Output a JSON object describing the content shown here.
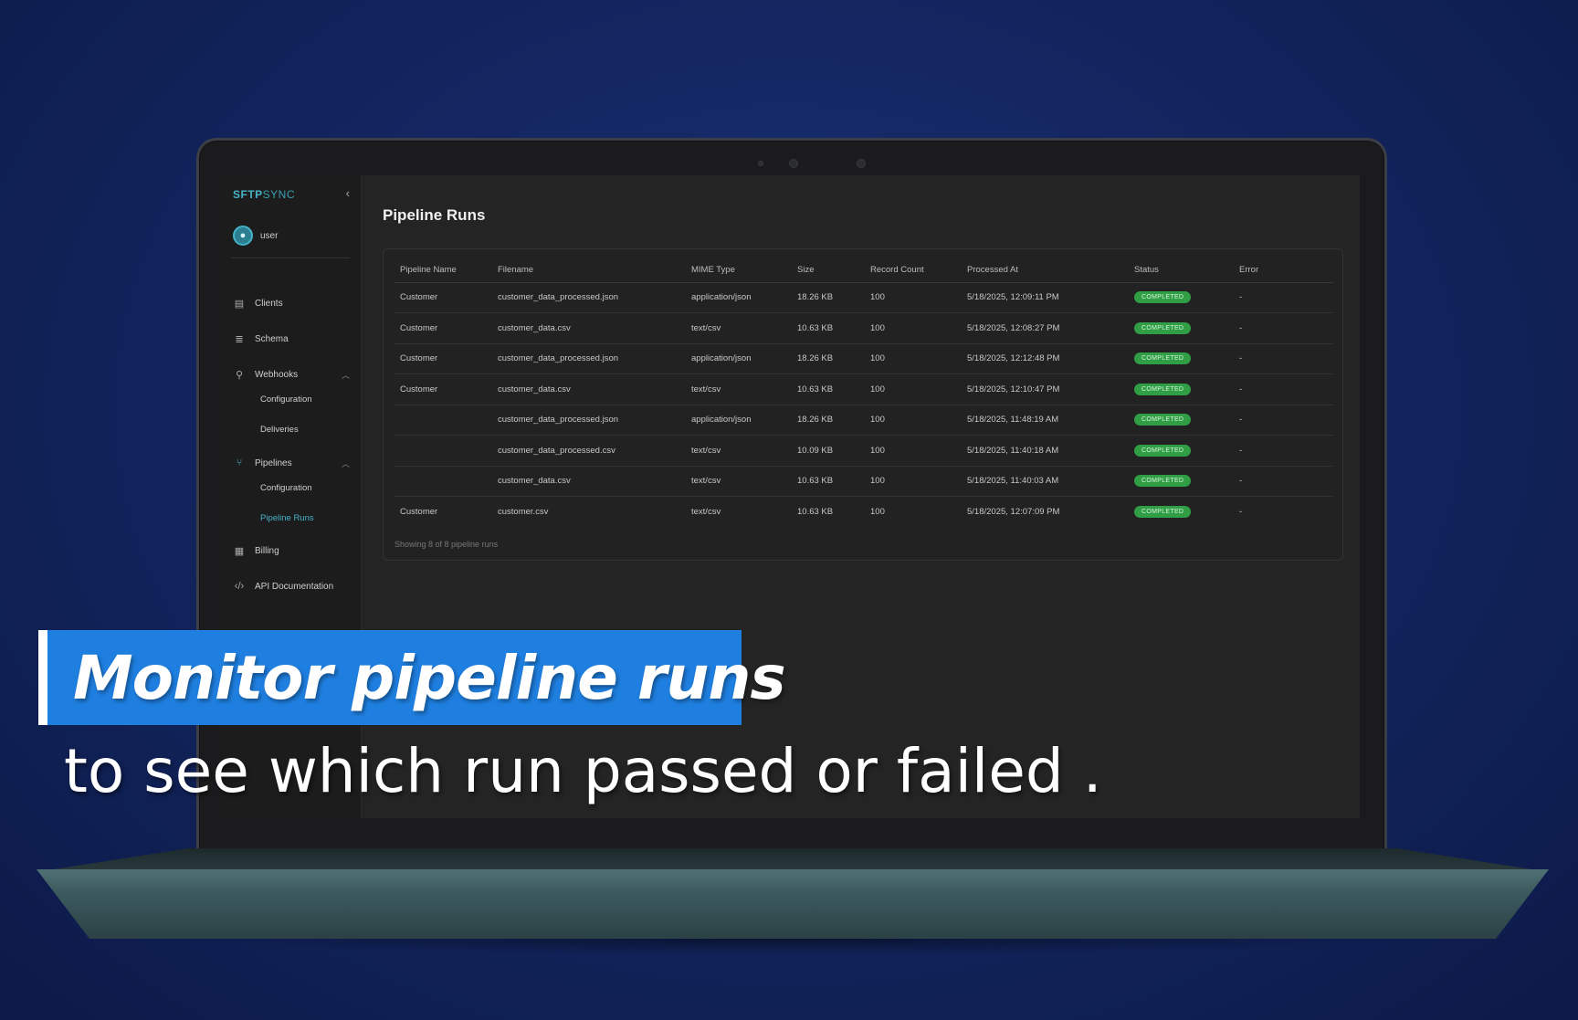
{
  "app": {
    "brand_bold": "SFTP",
    "brand_light": "SYNC",
    "user": "user"
  },
  "sidebar": {
    "items": [
      {
        "label": "Clients",
        "icon": "server-icon"
      },
      {
        "label": "Schema",
        "icon": "database-icon"
      },
      {
        "label": "Webhooks",
        "icon": "webhook-icon"
      },
      {
        "label": "Configuration"
      },
      {
        "label": "Deliveries"
      },
      {
        "label": "Pipelines",
        "icon": "git-branch-icon"
      },
      {
        "label": "Configuration"
      },
      {
        "label": "Pipeline Runs"
      },
      {
        "label": "Billing",
        "icon": "receipt-icon"
      },
      {
        "label": "API Documentation",
        "icon": "code-icon"
      }
    ]
  },
  "main": {
    "title": "Pipeline Runs",
    "columns": [
      "Pipeline Name",
      "Filename",
      "MIME Type",
      "Size",
      "Record Count",
      "Processed At",
      "Status",
      "Error"
    ],
    "rows": [
      {
        "pipeline": "Customer",
        "filename": "customer_data_processed.json",
        "mime": "application/json",
        "size": "18.26 KB",
        "records": "100",
        "processed": "5/18/2025, 12:09:11 PM",
        "status": "COMPLETED",
        "error": "-"
      },
      {
        "pipeline": "Customer",
        "filename": "customer_data.csv",
        "mime": "text/csv",
        "size": "10.63 KB",
        "records": "100",
        "processed": "5/18/2025, 12:08:27 PM",
        "status": "COMPLETED",
        "error": "-"
      },
      {
        "pipeline": "Customer",
        "filename": "customer_data_processed.json",
        "mime": "application/json",
        "size": "18.26 KB",
        "records": "100",
        "processed": "5/18/2025, 12:12:48 PM",
        "status": "COMPLETED",
        "error": "-"
      },
      {
        "pipeline": "Customer",
        "filename": "customer_data.csv",
        "mime": "text/csv",
        "size": "10.63 KB",
        "records": "100",
        "processed": "5/18/2025, 12:10:47 PM",
        "status": "COMPLETED",
        "error": "-"
      },
      {
        "pipeline": "",
        "filename": "customer_data_processed.json",
        "mime": "application/json",
        "size": "18.26 KB",
        "records": "100",
        "processed": "5/18/2025, 11:48:19 AM",
        "status": "COMPLETED",
        "error": "-"
      },
      {
        "pipeline": "",
        "filename": "customer_data_processed.csv",
        "mime": "text/csv",
        "size": "10.09 KB",
        "records": "100",
        "processed": "5/18/2025, 11:40:18 AM",
        "status": "COMPLETED",
        "error": "-"
      },
      {
        "pipeline": "",
        "filename": "customer_data.csv",
        "mime": "text/csv",
        "size": "10.63 KB",
        "records": "100",
        "processed": "5/18/2025, 11:40:03 AM",
        "status": "COMPLETED",
        "error": "-"
      },
      {
        "pipeline": "Customer",
        "filename": "customer.csv",
        "mime": "text/csv",
        "size": "10.63 KB",
        "records": "100",
        "processed": "5/18/2025, 12:07:09 PM",
        "status": "COMPLETED",
        "error": "-"
      }
    ],
    "footer": "Showing 8 of 8 pipeline runs"
  },
  "overlay": {
    "headline": "Monitor pipeline runs",
    "subline": "to see which run passed or failed ."
  },
  "colors": {
    "accent": "#45b3c8",
    "status_completed": "#2f9e44",
    "caption_bg": "#1f7fe0",
    "background": "#132661"
  }
}
